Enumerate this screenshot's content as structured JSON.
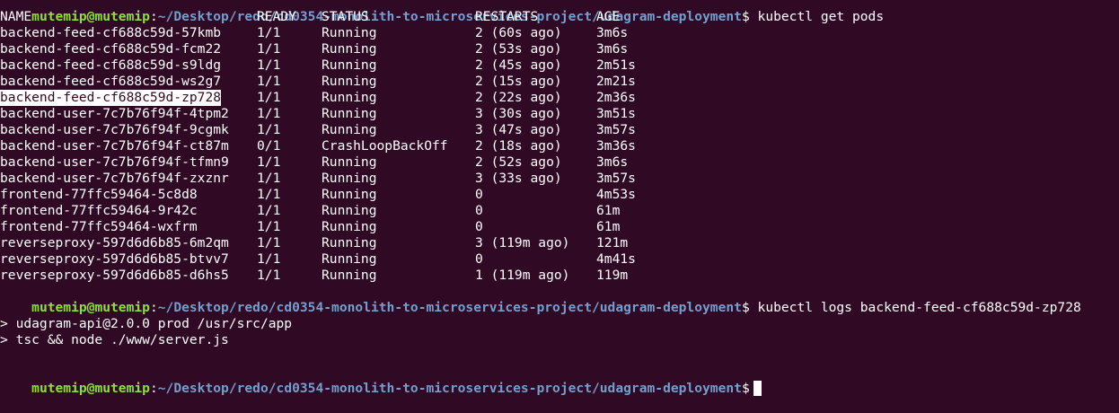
{
  "prompt": {
    "user_host": "mutemip@mutemip",
    "path": "~/Desktop/redo/cd0354-monolith-to-microservices-project/udagram-deployment",
    "symbol": "$"
  },
  "commands": {
    "first": "kubectl get pods",
    "second": "kubectl logs backend-feed-cf688c59d-zp728"
  },
  "table": {
    "headers": [
      "NAME",
      "READY",
      "STATUS",
      "RESTARTS",
      "AGE"
    ],
    "rows": [
      {
        "name": "backend-feed-cf688c59d-57kmb",
        "ready": "1/1",
        "status": "Running",
        "restarts": "2 (60s ago)",
        "age": "3m6s"
      },
      {
        "name": "backend-feed-cf688c59d-fcm22",
        "ready": "1/1",
        "status": "Running",
        "restarts": "2 (53s ago)",
        "age": "3m6s"
      },
      {
        "name": "backend-feed-cf688c59d-s9ldg",
        "ready": "1/1",
        "status": "Running",
        "restarts": "2 (45s ago)",
        "age": "2m51s"
      },
      {
        "name": "backend-feed-cf688c59d-ws2g7",
        "ready": "1/1",
        "status": "Running",
        "restarts": "2 (15s ago)",
        "age": "2m21s"
      },
      {
        "name": "backend-feed-cf688c59d-zp728",
        "ready": "1/1",
        "status": "Running",
        "restarts": "2 (22s ago)",
        "age": "2m36s"
      },
      {
        "name": "backend-user-7c7b76f94f-4tpm2",
        "ready": "1/1",
        "status": "Running",
        "restarts": "3 (30s ago)",
        "age": "3m51s"
      },
      {
        "name": "backend-user-7c7b76f94f-9cgmk",
        "ready": "1/1",
        "status": "Running",
        "restarts": "3 (47s ago)",
        "age": "3m57s"
      },
      {
        "name": "backend-user-7c7b76f94f-ct87m",
        "ready": "0/1",
        "status": "CrashLoopBackOff",
        "restarts": "2 (18s ago)",
        "age": "3m36s"
      },
      {
        "name": "backend-user-7c7b76f94f-tfmn9",
        "ready": "1/1",
        "status": "Running",
        "restarts": "2 (52s ago)",
        "age": "3m6s"
      },
      {
        "name": "backend-user-7c7b76f94f-zxznr",
        "ready": "1/1",
        "status": "Running",
        "restarts": "3 (33s ago)",
        "age": "3m57s"
      },
      {
        "name": "frontend-77ffc59464-5c8d8",
        "ready": "1/1",
        "status": "Running",
        "restarts": "0",
        "age": "4m53s"
      },
      {
        "name": "frontend-77ffc59464-9r42c",
        "ready": "1/1",
        "status": "Running",
        "restarts": "0",
        "age": "61m"
      },
      {
        "name": "frontend-77ffc59464-wxfrm",
        "ready": "1/1",
        "status": "Running",
        "restarts": "0",
        "age": "61m"
      },
      {
        "name": "reverseproxy-597d6d6b85-6m2qm",
        "ready": "1/1",
        "status": "Running",
        "restarts": "3 (119m ago)",
        "age": "121m"
      },
      {
        "name": "reverseproxy-597d6d6b85-btvv7",
        "ready": "1/1",
        "status": "Running",
        "restarts": "0",
        "age": "4m41s"
      },
      {
        "name": "reverseproxy-597d6d6b85-d6hs5",
        "ready": "1/1",
        "status": "Running",
        "restarts": "1 (119m ago)",
        "age": "119m"
      }
    ]
  },
  "logs": [
    "> udagram-api@2.0.0 prod /usr/src/app",
    "> tsc && node ./www/server.js"
  ],
  "colors": {
    "background": "#300a24",
    "prompt_user": "#8ae234",
    "prompt_path": "#729fcf",
    "text": "#ffffff"
  }
}
